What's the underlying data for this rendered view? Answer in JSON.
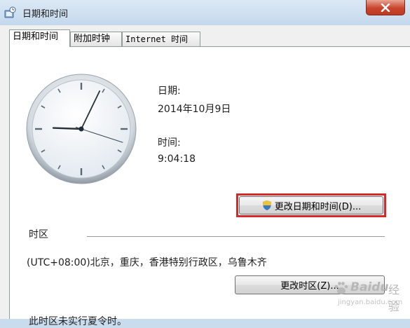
{
  "window": {
    "title": "日期和时间"
  },
  "tabs": [
    {
      "label": "日期和时间",
      "active": true
    },
    {
      "label": "附加时钟",
      "active": false
    },
    {
      "label": "Internet 时间",
      "active": false
    }
  ],
  "date_section": {
    "label": "日期:",
    "value": "2014年10月9日"
  },
  "time_section": {
    "label": "时间:",
    "value": "9:04:18"
  },
  "change_datetime_button": {
    "label": "更改日期和时间(D)..."
  },
  "timezone": {
    "label": "时区",
    "value": "(UTC+08:00)北京，重庆，香港特别行政区，乌鲁木齐",
    "change_button_label": "更改时区(Z)...",
    "dst_note": "此时区未实行夏令时。"
  },
  "watermark": {
    "brand": "Baidu",
    "sub": "经验",
    "url": "jingyan.baidu.com"
  },
  "clock": {
    "hour": 9,
    "minute": 4,
    "second": 18
  },
  "colors": {
    "highlight": "#d42a2a",
    "clock_face": "#eef2f6"
  },
  "icons": [
    "clock-settings-icon",
    "close-icon",
    "uac-shield-icon"
  ]
}
